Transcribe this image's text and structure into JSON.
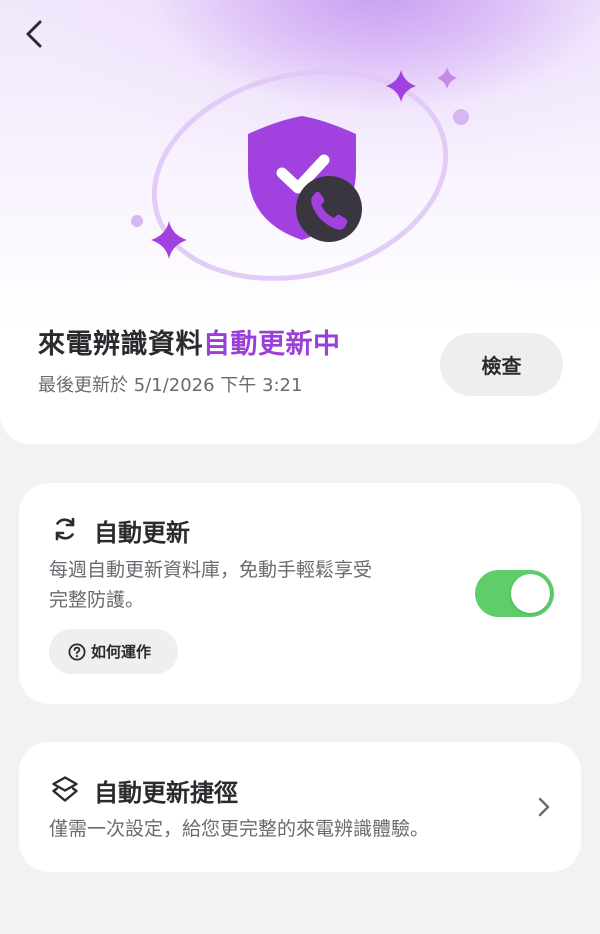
{
  "header": {
    "title_main": "來電辨識資料",
    "title_accent": "自動更新中",
    "last_updated": "最後更新於 5/1/2026 下午 3:21",
    "check_label": "檢查"
  },
  "auto_update": {
    "title": "自動更新",
    "description_line1": "每週自動更新資料庫，免動手輕鬆享受",
    "description_line2": "完整防護。",
    "toggle_on": true,
    "how_it_works_label": "如何運作"
  },
  "shortcut": {
    "title": "自動更新捷徑",
    "description": "僅需一次設定，給您更完整的來電辨識體驗。"
  },
  "colors": {
    "accent": "#9a3fd8",
    "toggle_on": "#5fcd6a",
    "shield": "#a142e0",
    "phone": "#3a3640"
  },
  "icons": {
    "back": "chevron-left-icon",
    "shield": "shield-check-icon",
    "phone": "phone-icon",
    "refresh": "refresh-icon",
    "help": "question-circle-icon",
    "shortcut": "shortcuts-icon",
    "chevron": "chevron-right-icon"
  }
}
